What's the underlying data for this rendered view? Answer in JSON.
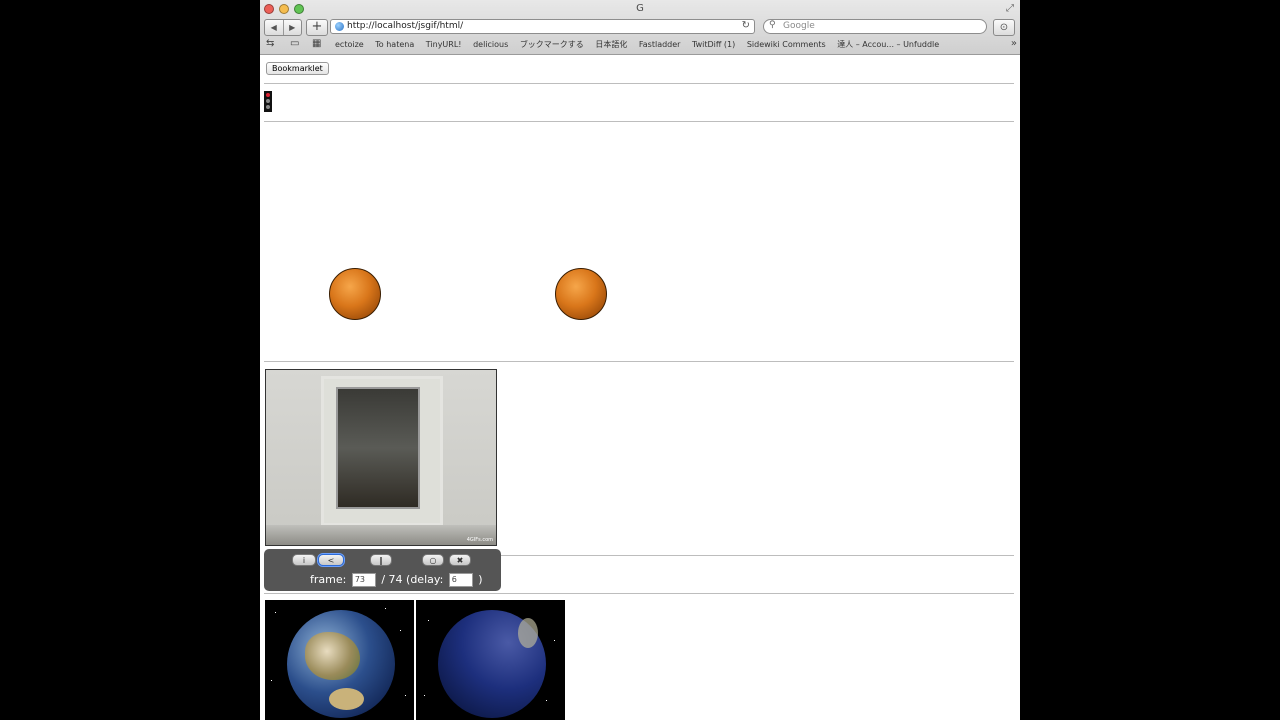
{
  "browser": {
    "title": "G",
    "url": "http://localhost/jsgif/html/",
    "search_placeholder": "Google",
    "bookmarks": [
      "ectoize",
      "To hatena",
      "TinyURL!",
      "delicious",
      "ブックマークする",
      "日本語化",
      "Fastladder",
      "TwitDiff (1)",
      "Sidewiki Comments",
      "達人 – Accou... – Unfuddle"
    ]
  },
  "page": {
    "bookmarklet_label": "Bookmarklet"
  },
  "player": {
    "btn_info": "i",
    "btn_step_back": "<",
    "btn_pause": "‖",
    "btn_step": "○",
    "btn_close": "✖",
    "frame_label": "frame:",
    "frame_value": "73",
    "frame_total": "/ 74 (delay:",
    "delay_value": "6",
    "delay_close": ")"
  },
  "cat_credit": "4GIFs.com",
  "icons": {
    "back": "back-arrow-icon",
    "forward": "forward-arrow-icon",
    "add": "plus-icon",
    "reload": "reload-icon",
    "search": "magnifier-icon",
    "download": "download-icon",
    "reader": "reading-list-icon",
    "topsites": "top-sites-icon"
  }
}
